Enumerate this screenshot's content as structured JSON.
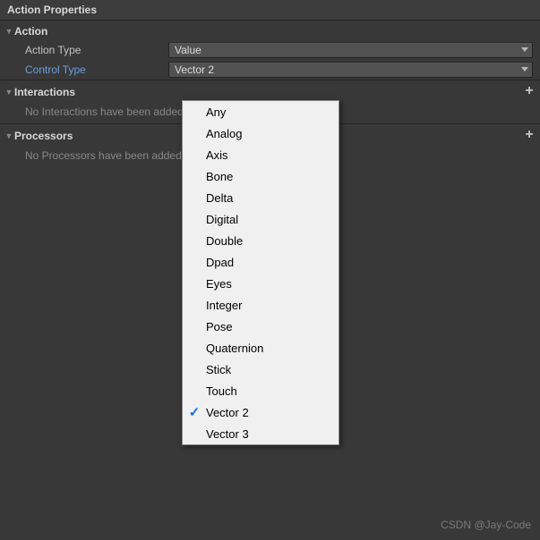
{
  "panel": {
    "title": "Action Properties"
  },
  "action": {
    "title": "Action",
    "actionTypeLabel": "Action Type",
    "actionTypeValue": "Value",
    "controlTypeLabel": "Control Type",
    "controlTypeValue": "Vector 2"
  },
  "interactions": {
    "title": "Interactions",
    "empty": "No Interactions have been added."
  },
  "processors": {
    "title": "Processors",
    "empty": "No Processors have been added."
  },
  "controlTypeOptions": [
    {
      "label": "Any",
      "selected": false
    },
    {
      "label": "Analog",
      "selected": false
    },
    {
      "label": "Axis",
      "selected": false
    },
    {
      "label": "Bone",
      "selected": false
    },
    {
      "label": "Delta",
      "selected": false
    },
    {
      "label": "Digital",
      "selected": false
    },
    {
      "label": "Double",
      "selected": false
    },
    {
      "label": "Dpad",
      "selected": false
    },
    {
      "label": "Eyes",
      "selected": false
    },
    {
      "label": "Integer",
      "selected": false
    },
    {
      "label": "Pose",
      "selected": false
    },
    {
      "label": "Quaternion",
      "selected": false
    },
    {
      "label": "Stick",
      "selected": false
    },
    {
      "label": "Touch",
      "selected": false
    },
    {
      "label": "Vector 2",
      "selected": true
    },
    {
      "label": "Vector 3",
      "selected": false
    }
  ],
  "watermark": "CSDN @Jay-Code"
}
